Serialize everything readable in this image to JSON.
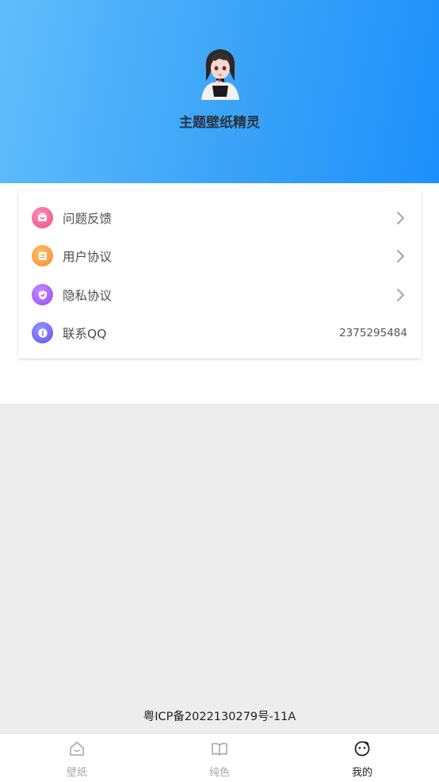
{
  "profile": {
    "app_name": "主题壁纸精灵"
  },
  "menu": {
    "items": [
      {
        "label": "问题反馈",
        "icon": "feedback-icon",
        "color": "#f35b8c",
        "has_arrow": true
      },
      {
        "label": "用户协议",
        "icon": "document-icon",
        "color": "#fb9a3a",
        "has_arrow": true
      },
      {
        "label": "隐私协议",
        "icon": "shield-icon",
        "color": "#a25df4",
        "has_arrow": true
      },
      {
        "label": "联系QQ",
        "icon": "info-icon",
        "color": "#6a64f5",
        "value": "2375295484"
      }
    ]
  },
  "footer": {
    "icp": "粤ICP备2022130279号-11A"
  },
  "tabbar": {
    "tabs": [
      {
        "label": "壁纸",
        "icon": "home-icon",
        "active": false
      },
      {
        "label": "纯色",
        "icon": "book-icon",
        "active": false
      },
      {
        "label": "我的",
        "icon": "smiley-icon",
        "active": true
      }
    ]
  },
  "colors": {
    "header_start": "#61bdfb",
    "header_end": "#1e90fb",
    "tab_active": "#222222",
    "tab_inactive": "#a8a8a8"
  }
}
